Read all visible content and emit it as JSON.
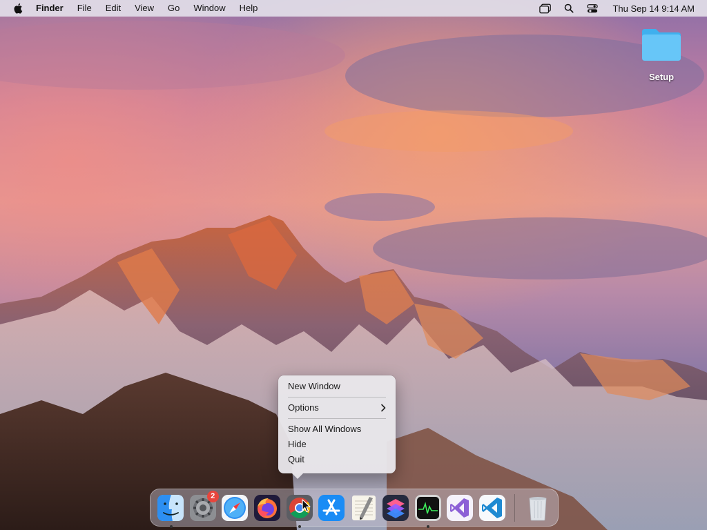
{
  "menubar": {
    "apple_icon": "apple-logo-icon",
    "app_name": "Finder",
    "menus": [
      "File",
      "Edit",
      "View",
      "Go",
      "Window",
      "Help"
    ],
    "status_icons": [
      "window-switcher-icon",
      "search-icon",
      "control-center-icon"
    ],
    "clock": "Thu Sep 14  9:14 AM"
  },
  "desktop": {
    "icons": [
      {
        "label": "Setup",
        "icon": "folder-icon",
        "color": "#5ac8fa"
      }
    ]
  },
  "context_menu": {
    "items": [
      {
        "label": "New Window"
      },
      {
        "separator": true
      },
      {
        "label": "Options",
        "submenu": true
      },
      {
        "separator": true
      },
      {
        "label": "Show All Windows"
      },
      {
        "label": "Hide"
      },
      {
        "label": "Quit"
      }
    ]
  },
  "dock": {
    "apps": [
      {
        "name": "finder",
        "icon": "finder-icon",
        "running": true
      },
      {
        "name": "system-settings",
        "icon": "gear-icon",
        "badge": "2",
        "running": false
      },
      {
        "name": "safari",
        "icon": "compass-icon",
        "running": false
      },
      {
        "name": "firefox",
        "icon": "firefox-icon",
        "running": false
      },
      {
        "name": "chrome",
        "icon": "chrome-icon",
        "running": true
      },
      {
        "name": "app-store",
        "icon": "app-store-icon",
        "running": false
      },
      {
        "name": "textedit",
        "icon": "textedit-icon",
        "running": false
      },
      {
        "name": "shortcuts",
        "icon": "shortcuts-icon",
        "running": false
      },
      {
        "name": "activity-monitor",
        "icon": "activity-monitor-icon",
        "running": true
      },
      {
        "name": "visual-studio",
        "icon": "visual-studio-icon",
        "running": false
      },
      {
        "name": "vscode",
        "icon": "vscode-icon",
        "running": false
      }
    ],
    "trash": {
      "icon": "trash-icon"
    }
  }
}
